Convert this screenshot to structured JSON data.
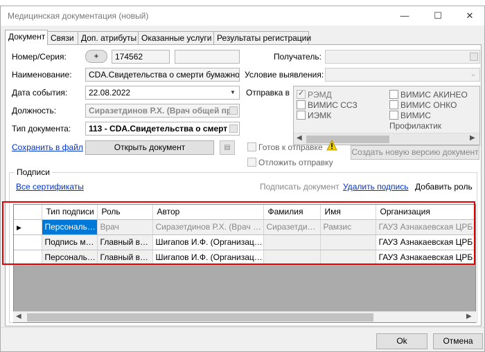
{
  "window": {
    "title": "Медицинская документация (новый)",
    "minimize": "—",
    "maximize": "☐",
    "close": "✕"
  },
  "tabs": [
    "Документ",
    "Связи",
    "Доп. атрибуты",
    "Оказанные услуги",
    "Результаты регистрации"
  ],
  "form": {
    "number_label": "Номер/Серия:",
    "plus_button": "+",
    "number_value": "174562",
    "series_value": "",
    "name_label": "Наименование:",
    "name_value": "CDA.Свидетельства о смерти бумажное",
    "date_label": "Дата события:",
    "date_value": "22.08.2022",
    "position_label": "Должность:",
    "position_value": "Сиразетдинов Р.Х. (Врач общей пр",
    "doctype_label": "Тип документа:",
    "doctype_value": "113 - CDA.Свидетельства о смерт",
    "save_link": "Сохранить в файл",
    "open_button": "Открыть документ",
    "recipient_label": "Получатель:",
    "condition_label": "Условие выявления:",
    "send_to_label": "Отправка в",
    "ready_label": "Готов к отправке",
    "postpone_label": "Отложить отправку",
    "new_version_button": "Создать новую версию документ"
  },
  "send_options": [
    {
      "label": "РЭМД",
      "checked": true
    },
    {
      "label": "ВИМИС АКИНЕО",
      "checked": false
    },
    {
      "label": "ВИМИС ССЗ",
      "checked": false
    },
    {
      "label": "ВИМИС ОНКО",
      "checked": false
    },
    {
      "label": "ИЭМК",
      "checked": false
    },
    {
      "label": "ВИМИС Профилактик",
      "checked": false
    }
  ],
  "signatures": {
    "group_label": "Подписи",
    "all_certs_link": "Все сертификаты",
    "sign_button": "Подписать документ",
    "delete_link": "Удалить подпись",
    "add_role_button": "Добавить роль",
    "columns": [
      "Тип подписи",
      "Роль",
      "Автор",
      "Фамилия",
      "Имя",
      "Организация"
    ],
    "rows": [
      [
        "Персональн...",
        "Врач",
        "Сиразетдинов Р.Х. (Врач об...",
        "Сиразетдинов",
        "Рамзис",
        "ГАУЗ Азнакаевская ЦРБ"
      ],
      [
        "Подпись ме...",
        "Главный врач",
        "Шигапов И.Ф. (Организаци...",
        "",
        "",
        "ГАУЗ Азнакаевская ЦРБ"
      ],
      [
        "Персональн...",
        "Главный врач",
        "Шигапов И.Ф. (Организаци...",
        "",
        "",
        "ГАУЗ Азнакаевская ЦРБ"
      ]
    ]
  },
  "footer": {
    "ok": "Ok",
    "cancel": "Отмена"
  },
  "colors": {
    "selection": "#0078d7",
    "highlight_border": "#e00000",
    "link": "#0033cc"
  }
}
